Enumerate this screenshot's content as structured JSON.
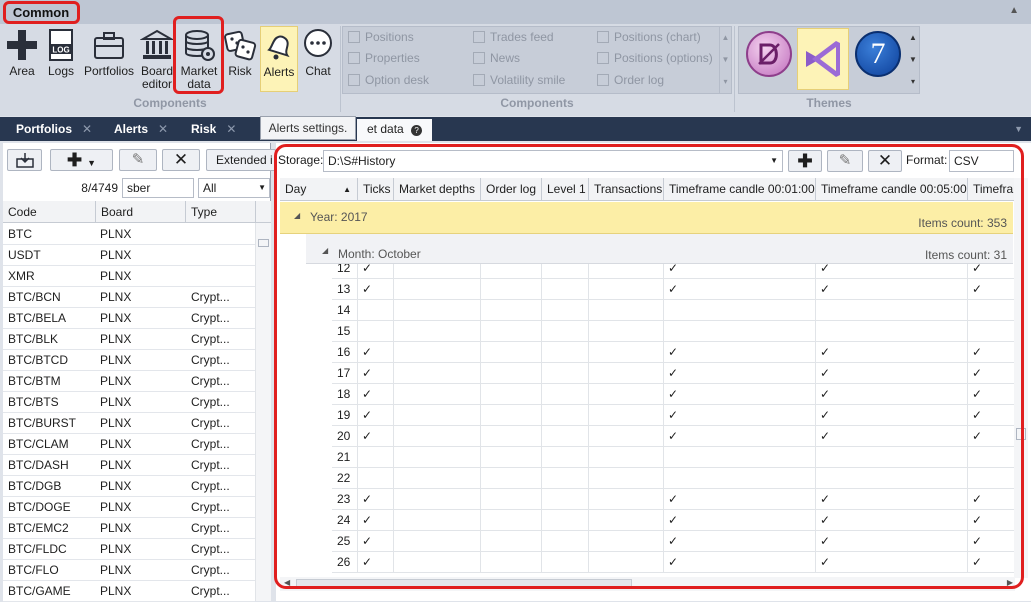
{
  "ribbon": {
    "tab": "Common",
    "buttons": [
      {
        "name": "area",
        "label": "Area"
      },
      {
        "name": "logs",
        "label": "Logs"
      },
      {
        "name": "portfolios",
        "label": "Portfolios"
      },
      {
        "name": "board-editor",
        "label": "Board editor"
      },
      {
        "name": "market-data",
        "label": "Market data"
      },
      {
        "name": "risk",
        "label": "Risk"
      },
      {
        "name": "alerts",
        "label": "Alerts"
      },
      {
        "name": "chat",
        "label": "Chat"
      }
    ],
    "group1_label": "Components",
    "components": [
      "Positions",
      "Trades feed",
      "Positions (chart)",
      "Properties",
      "News",
      "Positions (options)",
      "Option desk",
      "Volatility smile",
      "Order log"
    ],
    "group2_label": "Components",
    "group3_label": "Themes",
    "theme_seven": "7"
  },
  "doctabs": {
    "portfolios": "Portfolios",
    "alerts": "Alerts",
    "risk": "Risk",
    "tooltip": "Alerts settings.",
    "market_data_partial": "et data"
  },
  "left": {
    "extended": "Extended i",
    "count": "8/4749",
    "search_value": "sber",
    "filter_value": "All",
    "headers": [
      "Code",
      "Board",
      "Type"
    ],
    "rows": [
      [
        "BTC",
        "PLNX",
        ""
      ],
      [
        "USDT",
        "PLNX",
        ""
      ],
      [
        "XMR",
        "PLNX",
        ""
      ],
      [
        "BTC/BCN",
        "PLNX",
        "Crypt..."
      ],
      [
        "BTC/BELA",
        "PLNX",
        "Crypt..."
      ],
      [
        "BTC/BLK",
        "PLNX",
        "Crypt..."
      ],
      [
        "BTC/BTCD",
        "PLNX",
        "Crypt..."
      ],
      [
        "BTC/BTM",
        "PLNX",
        "Crypt..."
      ],
      [
        "BTC/BTS",
        "PLNX",
        "Crypt..."
      ],
      [
        "BTC/BURST",
        "PLNX",
        "Crypt..."
      ],
      [
        "BTC/CLAM",
        "PLNX",
        "Crypt..."
      ],
      [
        "BTC/DASH",
        "PLNX",
        "Crypt..."
      ],
      [
        "BTC/DGB",
        "PLNX",
        "Crypt..."
      ],
      [
        "BTC/DOGE",
        "PLNX",
        "Crypt..."
      ],
      [
        "BTC/EMC2",
        "PLNX",
        "Crypt..."
      ],
      [
        "BTC/FLDC",
        "PLNX",
        "Crypt..."
      ],
      [
        "BTC/FLO",
        "PLNX",
        "Crypt..."
      ],
      [
        "BTC/GAME",
        "PLNX",
        "Crypt..."
      ]
    ]
  },
  "right": {
    "storage_label": "Storage:",
    "storage_value": "D:\\S#History",
    "format_label": "Format:",
    "format_value": "CSV",
    "headers": [
      "Day",
      "Ticks",
      "Market depths",
      "Order log",
      "Level 1",
      "Transactions",
      "Timeframe candle 00:01:00",
      "Timeframe candle 00:05:00",
      "Timefra"
    ],
    "year_label": "Year: 2017",
    "year_count": "Items count: 353",
    "month_label": "Month: October",
    "month_count": "Items count: 31",
    "check": "✓",
    "days": [
      {
        "day": "12",
        "marks": true
      },
      {
        "day": "13",
        "marks": true
      },
      {
        "day": "14",
        "marks": false
      },
      {
        "day": "15",
        "marks": false
      },
      {
        "day": "16",
        "marks": true
      },
      {
        "day": "17",
        "marks": true
      },
      {
        "day": "18",
        "marks": true
      },
      {
        "day": "19",
        "marks": true
      },
      {
        "day": "20",
        "marks": true
      },
      {
        "day": "21",
        "marks": false
      },
      {
        "day": "22",
        "marks": false
      },
      {
        "day": "23",
        "marks": true
      },
      {
        "day": "24",
        "marks": true
      },
      {
        "day": "25",
        "marks": true
      },
      {
        "day": "26",
        "marks": true
      }
    ]
  }
}
